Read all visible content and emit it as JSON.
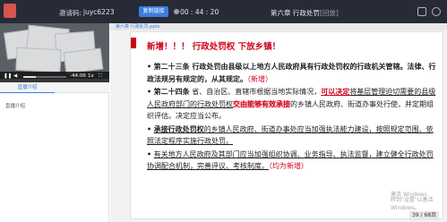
{
  "topbar": {
    "invite_label": "邀请码:",
    "invite_code": "juyc6223",
    "copy_button": "复制链接",
    "live_time": "00 : 44 : 20",
    "chapter_title": "第六章  行政处罚",
    "chapter_tag": "[回放]"
  },
  "player": {
    "time_elapsed": "-44:06",
    "speed": "1x",
    "progress": 0.3
  },
  "left_panel": {
    "tab_intro": "直播介绍",
    "section_label": "直播介绍"
  },
  "slide": {
    "file_name": "第六章 行政处罚.pptx",
    "headline": "新增！！！  行政处罚权  下放乡镇！",
    "p1": {
      "bullet": "•",
      "article": "第二十三条",
      "text1": "  行政处罚由县级以上地方人民政府具有行政处罚权的行政机关管辖。法律、行政法规另有规定的，从其规定。",
      "tag": "（新增）"
    },
    "p2": {
      "bullet": "•",
      "article": "第二十四条",
      "text1": "  省、自治区、直辖市根据当地实际情况，",
      "red1": "可以决定",
      "text2": "将基层管理迫切需要的县级人民政府部门的行政处罚权",
      "red2": "交由能够有效承接",
      "text3": "的乡镇人民政府、街道办事处行使，并定期组织评估。决定应当公布。"
    },
    "p3": {
      "bullet": "•",
      "lead": "承接行政处罚权",
      "text": "的乡镇人民政府、街道办事处应当加强执法能力建设，按照规定范围、依照法定程序实施行政处罚。"
    },
    "p4": {
      "bullet": "•",
      "text": "有关地方人民政府及其部门应当加强组织协调、业务指导、执法监督，建立健全行政处罚协调配合机制，完善评议、考核制度。",
      "tag": "（均为新增）"
    }
  },
  "watermark": {
    "line1": "激活 Windows",
    "line2": "转到\"设置\"以激活 Windows。"
  },
  "pager": {
    "label": "39 / 68页"
  },
  "colors": {
    "accent_red": "#d0021b",
    "accent_blue": "#3b7ddd",
    "topbar_bg": "#262b36"
  }
}
